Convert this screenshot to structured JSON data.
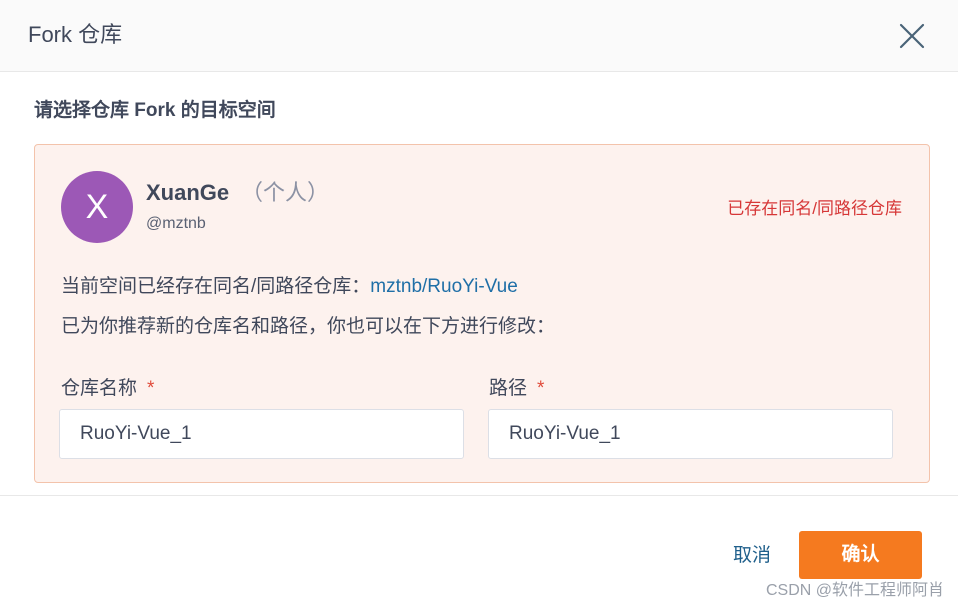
{
  "dialog": {
    "title": "Fork 仓库",
    "close_icon": "close-icon"
  },
  "section_label": "请选择仓库 Fork 的目标空间",
  "target": {
    "avatar_letter": "X",
    "avatar_color": "#9c58b6",
    "user_name": "XuanGe",
    "user_type": "（个人）",
    "user_handle": "@mztnb",
    "status": "已存在同名/同路径仓库",
    "message_prefix": "当前空间已经存在同名/同路径仓库：",
    "existing_repo": "mztnb/RuoYi-Vue",
    "recommend_message": "已为你推荐新的仓库名和路径，你也可以在下方进行修改："
  },
  "form": {
    "name_label": "仓库名称",
    "name_value": "RuoYi-Vue_1",
    "path_label": "路径",
    "path_value": "RuoYi-Vue_1",
    "required_mark": "*"
  },
  "footer": {
    "cancel_label": "取消",
    "confirm_label": "确认"
  },
  "watermark": "CSDN @软件工程师阿肖",
  "colors": {
    "accent": "#f57a1f",
    "warning": "#d63737",
    "link": "#1f6fa7",
    "card_bg": "#fdf2ee",
    "card_border": "#f3c3ab"
  }
}
